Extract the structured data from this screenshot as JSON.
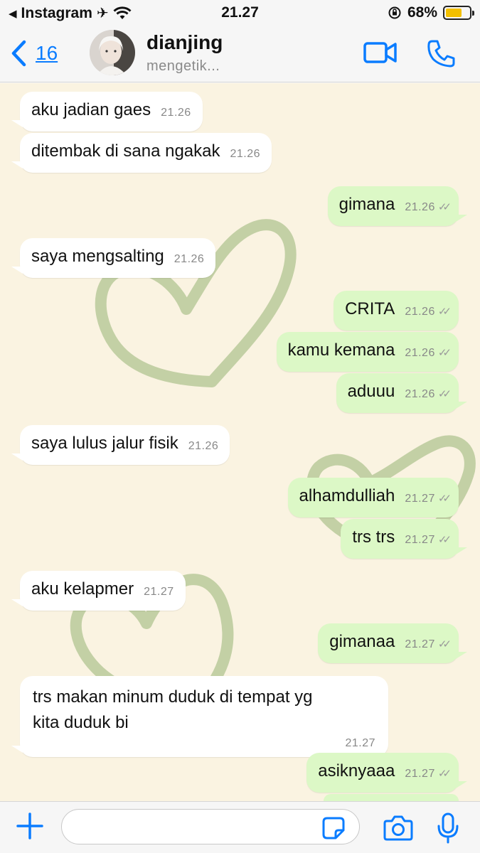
{
  "status_bar": {
    "back_app": "Instagram",
    "time": "21.27",
    "battery": "68%"
  },
  "header": {
    "back_count": "16",
    "contact_name": "dianjing",
    "contact_status": "mengetik..."
  },
  "messages": [
    {
      "dir": "in",
      "text": "aku jadian gaes",
      "time": "21.26"
    },
    {
      "dir": "in",
      "text": "ditembak di sana ngakak",
      "time": "21.26"
    },
    {
      "dir": "out",
      "text": "gimana",
      "time": "21.26"
    },
    {
      "dir": "in",
      "text": "saya mengsalting",
      "time": "21.26"
    },
    {
      "dir": "out",
      "text": "CRITA",
      "time": "21.26"
    },
    {
      "dir": "out",
      "text": "kamu kemana",
      "time": "21.26"
    },
    {
      "dir": "out",
      "text": "aduuu",
      "time": "21.26"
    },
    {
      "dir": "in",
      "text": "saya lulus jalur fisik",
      "time": "21.26"
    },
    {
      "dir": "out",
      "text": "alhamdulliah",
      "time": "21.27"
    },
    {
      "dir": "out",
      "text": "trs trs",
      "time": "21.27"
    },
    {
      "dir": "in",
      "text": "aku kelapmer",
      "time": "21.27"
    },
    {
      "dir": "out",
      "text": "gimanaa",
      "time": "21.27"
    },
    {
      "dir": "in",
      "text_line1": "trs makan minum duduk di tempat yg",
      "text_line2": "kita duduk bi",
      "time": "21.27"
    },
    {
      "dir": "out",
      "text": "asiknyaaa",
      "time": "21.27"
    }
  ],
  "input": {
    "placeholder": ""
  },
  "colors": {
    "accent": "#0a7cff",
    "chat_bg": "#faf3e1",
    "outgoing_bubble": "#dcf8c6",
    "incoming_bubble": "#ffffff",
    "heart": "#b9c99a"
  }
}
